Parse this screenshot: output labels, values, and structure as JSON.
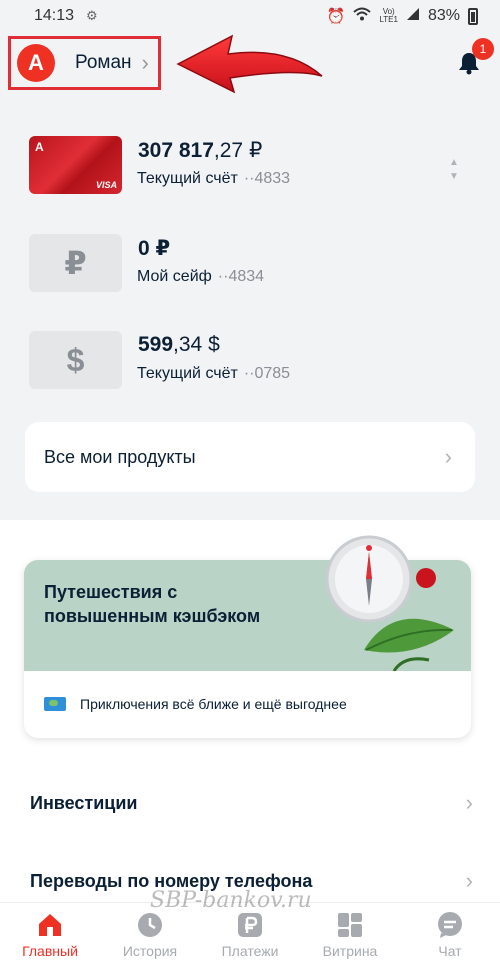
{
  "status_bar": {
    "time": "14:13",
    "network_top": "Vo)",
    "network_bottom": "LTE1",
    "battery": "83%"
  },
  "header": {
    "bank_logo": "А",
    "user_name": "Роман",
    "notification_count": "1"
  },
  "accounts": [
    {
      "amount_int": "307 817",
      "amount_frac": ",27 ₽",
      "label": "Текущий счёт",
      "mask": "··4833",
      "thumb": "card",
      "card_logo": "А",
      "card_brand": "VISA"
    },
    {
      "amount_int": "0 ₽",
      "amount_frac": "",
      "label": "Мой сейф",
      "mask": "··4834",
      "thumb": "₽"
    },
    {
      "amount_int": "599",
      "amount_frac": ",34 $",
      "label": "Текущий счёт",
      "mask": "··0785",
      "thumb": "$"
    }
  ],
  "products": {
    "label": "Все мои продукты"
  },
  "promo": {
    "title": "Путешествия с повышенным кэшбэком",
    "subtitle": "Приключения всё ближе и ещё выгоднее"
  },
  "list": [
    {
      "label": "Инвестиции"
    },
    {
      "label": "Переводы по номеру телефона"
    }
  ],
  "tabs": [
    {
      "label": "Главный",
      "icon": "home-icon",
      "active": true
    },
    {
      "label": "История",
      "icon": "clock-icon"
    },
    {
      "label": "Платежи",
      "icon": "ruble-icon"
    },
    {
      "label": "Витрина",
      "icon": "grid-icon"
    },
    {
      "label": "Чат",
      "icon": "chat-icon"
    }
  ],
  "watermark": "SBP-bankov.ru",
  "colors": {
    "accent": "#ef3124",
    "highlight_border": "#e02e36",
    "promo_bg": "#b9d3c6"
  }
}
